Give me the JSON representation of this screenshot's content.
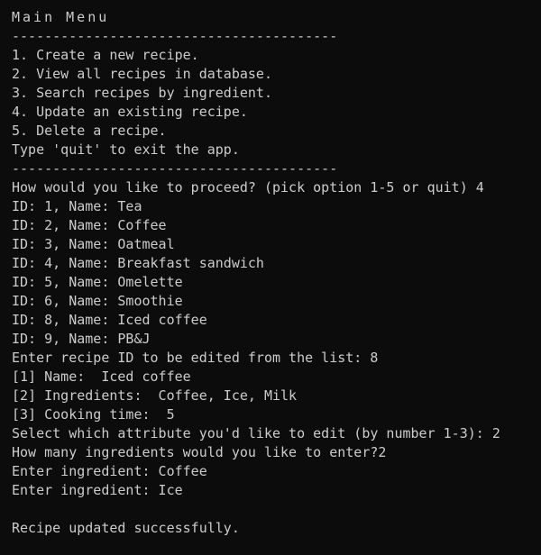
{
  "terminal": {
    "title": "Main Menu",
    "separator": "----------------------------------------",
    "menu": [
      "1. Create a new recipe.",
      "2. View all recipes in database.",
      "3. Search recipes by ingredient.",
      "4. Update an existing recipe.",
      "5. Delete a recipe.",
      "Type 'quit' to exit the app."
    ],
    "prompt_proceed": "How would you like to proceed? (pick option 1-5 or quit) 4",
    "recipes": [
      "ID: 1, Name: Tea",
      "ID: 2, Name: Coffee",
      "ID: 3, Name: Oatmeal",
      "ID: 4, Name: Breakfast sandwich",
      "ID: 5, Name: Omelette",
      "ID: 6, Name: Smoothie",
      "ID: 8, Name: Iced coffee",
      "ID: 9, Name: PB&J"
    ],
    "prompt_edit_id": "Enter recipe ID to be edited from the list: 8",
    "attributes": [
      "[1] Name:  Iced coffee",
      "[2] Ingredients:  Coffee, Ice, Milk",
      "[3] Cooking time:  5"
    ],
    "prompt_attribute": "Select which attribute you'd like to edit (by number 1-3): 2",
    "prompt_count": "How many ingredients would you like to enter?2",
    "ingredient_entries": [
      "Enter ingredient: Coffee",
      "Enter ingredient: Ice"
    ],
    "success": "Recipe updated successfully."
  },
  "colors": {
    "background": "#0c0c0c",
    "text": "#cccccc"
  }
}
